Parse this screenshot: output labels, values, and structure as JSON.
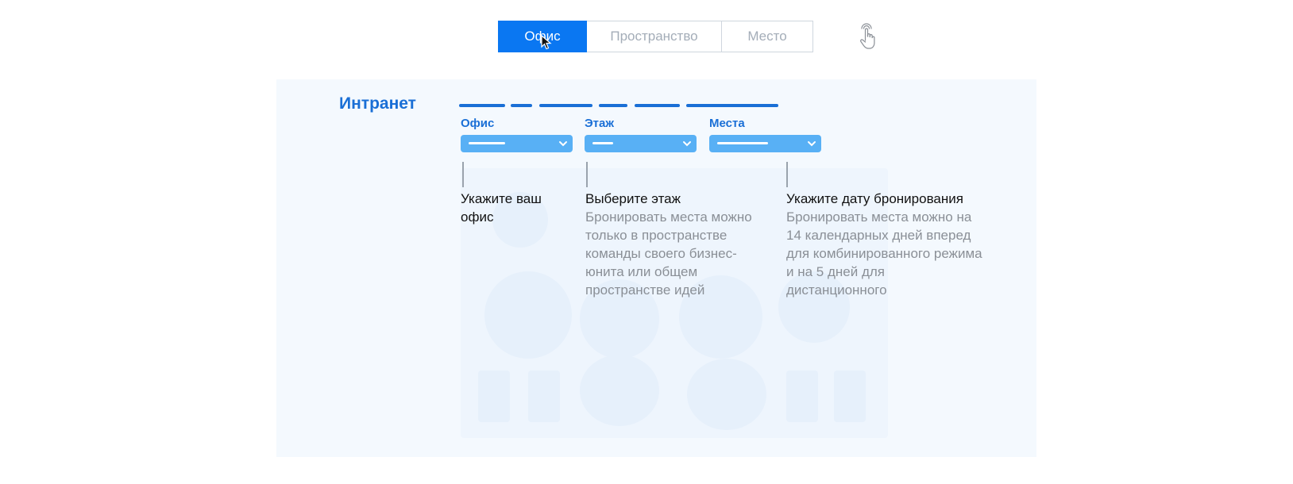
{
  "tabs": [
    {
      "label": "Офис",
      "active": true
    },
    {
      "label": "Пространство",
      "active": false
    },
    {
      "label": "Место",
      "active": false
    }
  ],
  "icons": {
    "cursor": "mouse-pointer-icon",
    "touch": "tap-gesture-icon",
    "chevron": "chevron-down-icon"
  },
  "colors": {
    "accent": "#0a77f2",
    "brand": "#1a6fd6",
    "select": "#58b0f5",
    "panel": "#f4f9fe"
  },
  "panel": {
    "brand": "Интранет",
    "fields": [
      {
        "label": "Офис"
      },
      {
        "label": "Этаж"
      },
      {
        "label": "Места"
      }
    ],
    "steps": [
      {
        "title": "Укажите ваш офис",
        "description": ""
      },
      {
        "title": "Выберите этаж",
        "description": "Бронировать места можно только в пространстве команды своего бизнес-юнита или общем пространстве идей"
      },
      {
        "title": "Укажите дату бронирования",
        "description": "Бронировать места можно на 14 календарных дней вперед для комбинированного режима и на 5 дней для дистанционного"
      }
    ]
  }
}
